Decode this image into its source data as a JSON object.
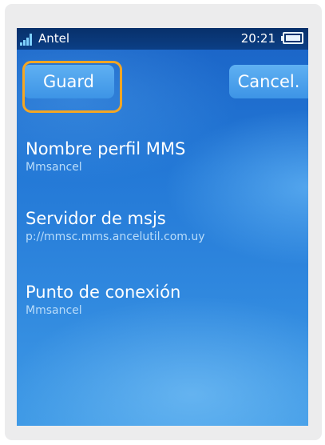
{
  "status_bar": {
    "carrier": "Antel",
    "time": "20:21"
  },
  "softkeys": {
    "left_label": "Guard",
    "right_label": "Cancel."
  },
  "fields": [
    {
      "label": "Nombre perfil MMS",
      "value": "Mmsancel"
    },
    {
      "label": "Servidor de msjs",
      "value": "p://mmsc.mms.ancelutil.com.uy"
    },
    {
      "label": "Punto de conexión",
      "value": "Mmsancel"
    }
  ],
  "colors": {
    "highlight": "#f4a623",
    "screen_top": "#1a63c6",
    "screen_bottom": "#3f9ae6"
  },
  "icons": [
    "signal-strength-icon",
    "battery-icon"
  ]
}
